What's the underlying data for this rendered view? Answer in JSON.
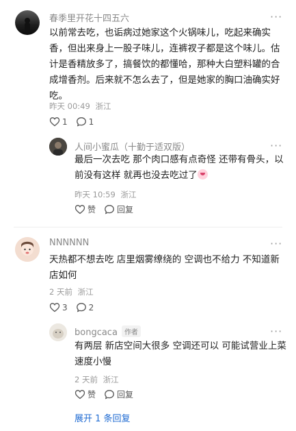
{
  "comments": [
    {
      "user": "春季里开花十四五六",
      "text": "以前常去吃，也诟病过她家这个火锅味儿，吃起来确实香，但出来身上一股子味儿，连裤衩子都是这个味儿。估计是香精放多了，搞餐饮的都懂哈，那种大白塑料罐的合成增香剂。后来就不怎么去了，但是她家的胸口油确实好吃。",
      "time": "昨天 00:49",
      "location": "浙江",
      "likes": "1",
      "replies": "1",
      "reply": {
        "user": "人间小蜜瓜（十勤于适双版）",
        "text": "最后一次去吃 那个肉口感有点奇怪 还带有骨头，以前没有这样 就再也没去吃过了",
        "time": "昨天 10:59",
        "location": "浙江",
        "like_label": "赞",
        "reply_label": "回复"
      }
    },
    {
      "user": "NNNNNN",
      "text": "天热都不想去吃 店里烟雾缭绕的 空调也不给力 不知道新店如何",
      "time": "2 天前",
      "location": "浙江",
      "likes": "3",
      "replies": "2",
      "reply": {
        "user": "bongcaca",
        "author_tag": "作者",
        "text": "有两层 新店空间大很多 空调还可以 可能试营业上菜速度小慢",
        "time": "2 天前",
        "location": "浙江",
        "like_label": "赞",
        "reply_label": "回复"
      },
      "expand_label": "展开 1 条回复"
    }
  ],
  "icons": {
    "more": "more-dots-icon",
    "like": "heart-icon",
    "reply": "comment-bubble-icon"
  },
  "colors": {
    "link": "#1e6ad2",
    "meta": "#999999"
  }
}
